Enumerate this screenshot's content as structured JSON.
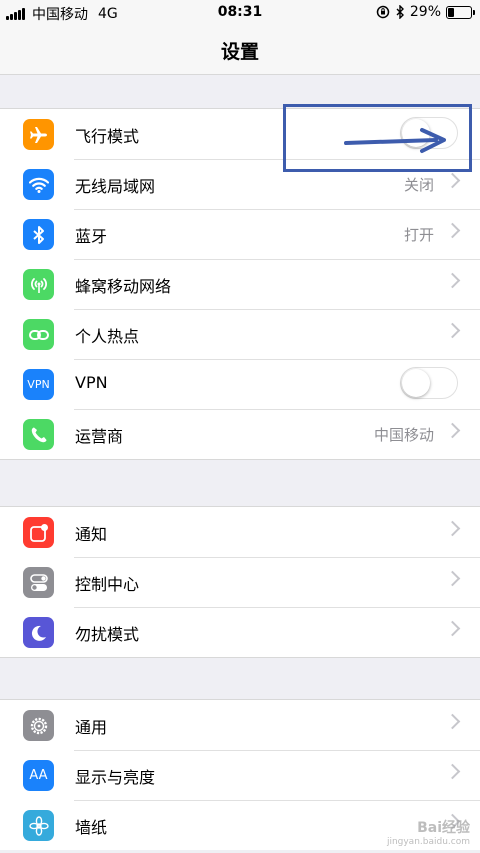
{
  "status_bar": {
    "carrier": "中国移动",
    "network": "4G",
    "time": "08:31",
    "battery_percent": "29%",
    "battery_level": 0.29
  },
  "nav": {
    "title": "设置"
  },
  "sections": [
    {
      "rows": [
        {
          "label": "飞行模式",
          "icon": "airplane-icon",
          "color": "#ff9500",
          "toggle": false
        },
        {
          "label": "无线局域网",
          "icon": "wifi-icon",
          "color": "#1a82fb",
          "value": "关闭"
        },
        {
          "label": "蓝牙",
          "icon": "bluetooth-icon",
          "color": "#1a82fb",
          "value": "打开"
        },
        {
          "label": "蜂窝移动网络",
          "icon": "cellular-icon",
          "color": "#4cd964"
        },
        {
          "label": "个人热点",
          "icon": "hotspot-icon",
          "color": "#4cd964"
        },
        {
          "label": "VPN",
          "icon": "vpn-icon",
          "color": "#1a82fb",
          "icon_text": "VPN",
          "toggle": false
        },
        {
          "label": "运营商",
          "icon": "phone-icon",
          "color": "#4cd964",
          "value": "中国移动"
        }
      ]
    },
    {
      "rows": [
        {
          "label": "通知",
          "icon": "notifications-icon",
          "color": "#ff3b30"
        },
        {
          "label": "控制中心",
          "icon": "control-center-icon",
          "color": "#8e8e93"
        },
        {
          "label": "勿扰模式",
          "icon": "moon-icon",
          "color": "#5856d6"
        }
      ]
    },
    {
      "rows": [
        {
          "label": "通用",
          "icon": "gear-icon",
          "color": "#8e8e93"
        },
        {
          "label": "显示与亮度",
          "icon": "display-icon",
          "color": "#1a82fb",
          "icon_text": "AA"
        },
        {
          "label": "墙纸",
          "icon": "wallpaper-icon",
          "color": "#35aadc"
        }
      ]
    }
  ],
  "watermark": {
    "text": "Bai经验",
    "sub": "jingyan.baidu.com"
  },
  "annotation": {
    "color": "#3d5cad"
  }
}
